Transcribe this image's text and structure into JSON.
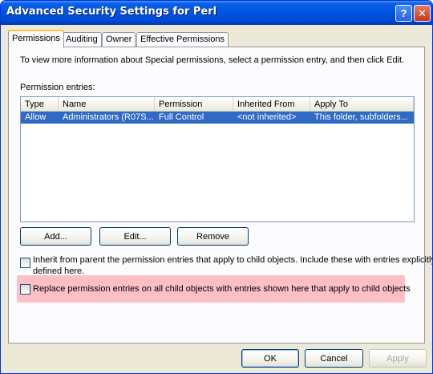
{
  "window": {
    "title": "Advanced Security Settings for Perl",
    "help_glyph": "?",
    "close_glyph": "✕"
  },
  "tabs": [
    {
      "label": "Permissions",
      "active": true
    },
    {
      "label": "Auditing",
      "active": false
    },
    {
      "label": "Owner",
      "active": false
    },
    {
      "label": "Effective Permissions",
      "active": false
    }
  ],
  "permissions": {
    "info_text": "To view more information about Special permissions, select a permission entry, and then click Edit.",
    "entries_label": "Permission entries:",
    "columns": [
      "Type",
      "Name",
      "Permission",
      "Inherited From",
      "Apply To"
    ],
    "rows": [
      {
        "type": "Allow",
        "name": "Administrators (R07S...",
        "permission": "Full Control",
        "inherited_from": "<not inherited>",
        "apply_to": "This folder, subfolders...",
        "selected": true
      }
    ],
    "buttons": {
      "add": "Add...",
      "edit": "Edit...",
      "remove": "Remove"
    },
    "inherit_checkbox": {
      "label_line1": "Inherit from parent the permission entries that apply to child objects. Include these with entries explicitly",
      "label_line2": "defined here.",
      "checked": false
    },
    "replace_checkbox": {
      "label": "Replace permission entries on all child objects with entries shown here that apply to child objects",
      "checked": false,
      "highlight_color": "#ff8c96"
    }
  },
  "footer": {
    "ok": "OK",
    "cancel": "Cancel",
    "apply": "Apply",
    "apply_disabled": true
  },
  "colors": {
    "titlebar": "#0054e3",
    "selection": "#316ac5",
    "dialog_bg": "#ece9d8"
  }
}
